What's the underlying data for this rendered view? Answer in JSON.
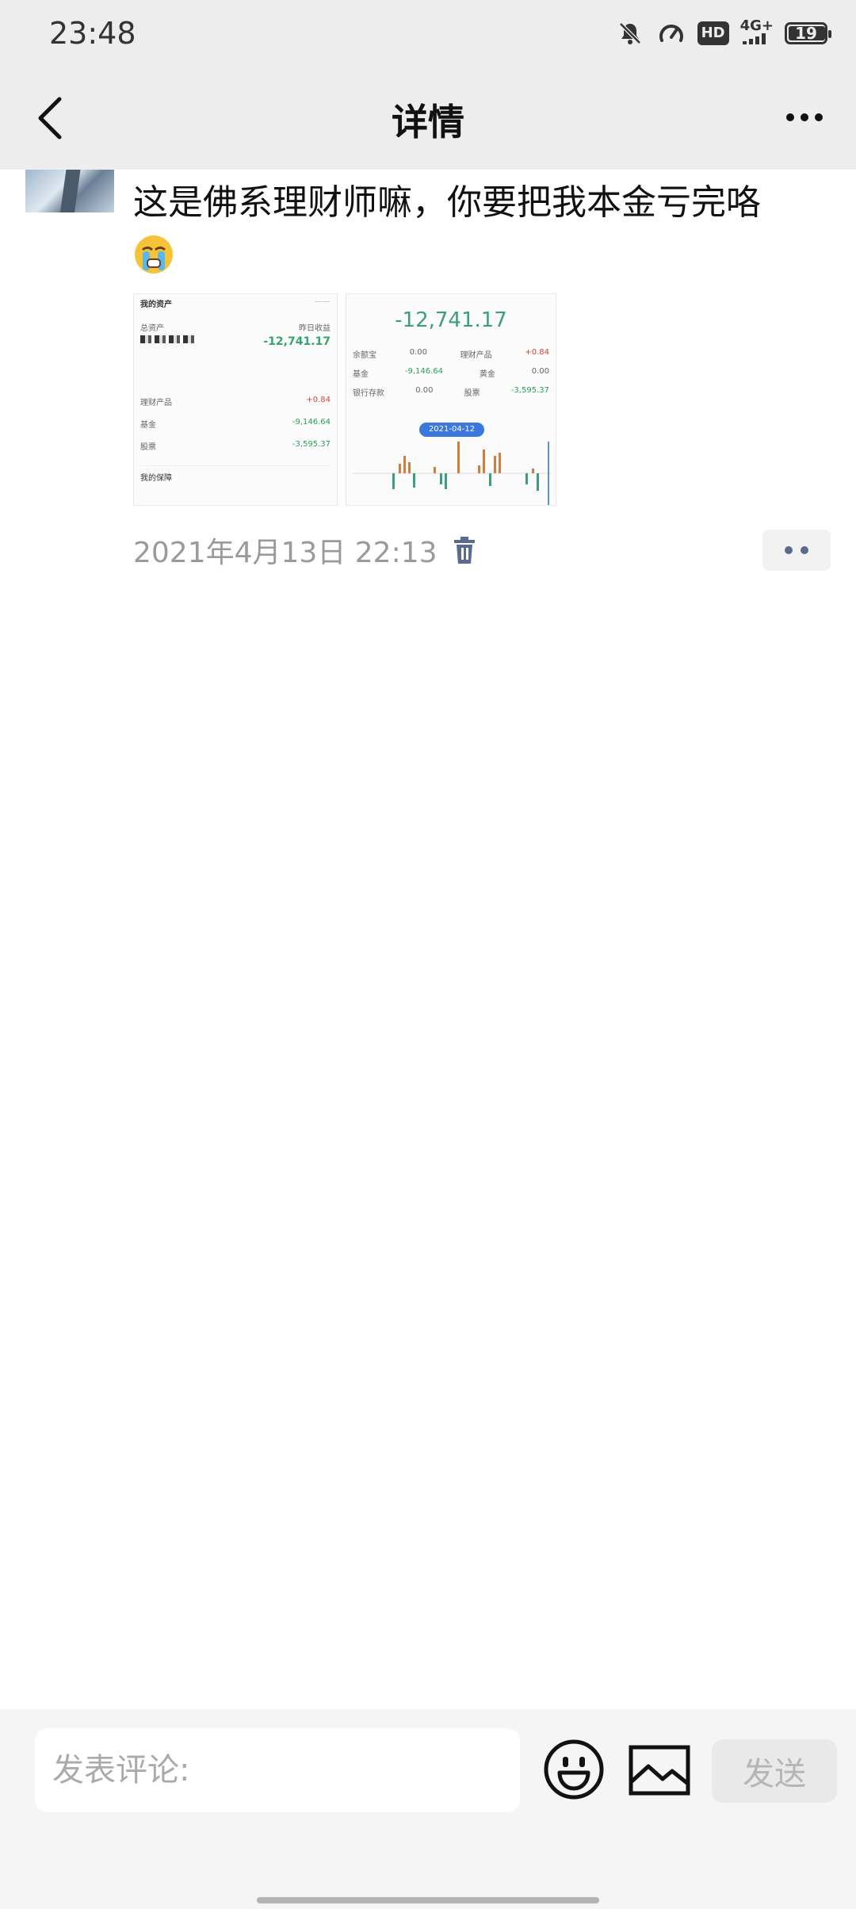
{
  "status_bar": {
    "time": "23:48",
    "icons": [
      "mute-bell-icon",
      "speed-icon",
      "hd-icon",
      "4g-signal-icon",
      "battery-icon"
    ],
    "hd_label": "HD",
    "network": "4G+",
    "battery": "19"
  },
  "header": {
    "title": "详情",
    "back_icon": "back-chevron-icon",
    "more_icon": "more-dots-icon"
  },
  "post": {
    "text": "这是佛系理财师嘛，你要把我本金亏完咯",
    "emoji": "crying-face-emoji",
    "timestamp": "2021年4月13日 22:13",
    "delete_icon": "trash-icon",
    "comment_icon": "comment-dots-icon",
    "image1": {
      "heading": "我的资产",
      "total_label": "总资产",
      "pnl_label": "昨日收益",
      "pnl_value": "-12,741.17",
      "rows": [
        {
          "label": "理财产品",
          "value": "+0.84"
        },
        {
          "label": "基金",
          "value": "-9,146.64"
        },
        {
          "label": "股票",
          "value": "-3,595.37"
        }
      ],
      "section": "我的保障"
    },
    "image2": {
      "amount": "-12,741.17",
      "rows": [
        {
          "label": "余额宝",
          "value": "0.00",
          "label2": "理财产品",
          "value2": "+0.84"
        },
        {
          "label": "基金",
          "value": "-9,146.64",
          "label2": "黄金",
          "value2": "0.00"
        },
        {
          "label": "银行存款",
          "value": "0.00",
          "label2": "股票",
          "value2": "-3,595.37"
        }
      ],
      "date_pill": "2021-04-12"
    }
  },
  "composer": {
    "placeholder": "发表评论:",
    "emoji_icon": "smiley-icon",
    "image_icon": "image-icon",
    "send_label": "发送"
  }
}
